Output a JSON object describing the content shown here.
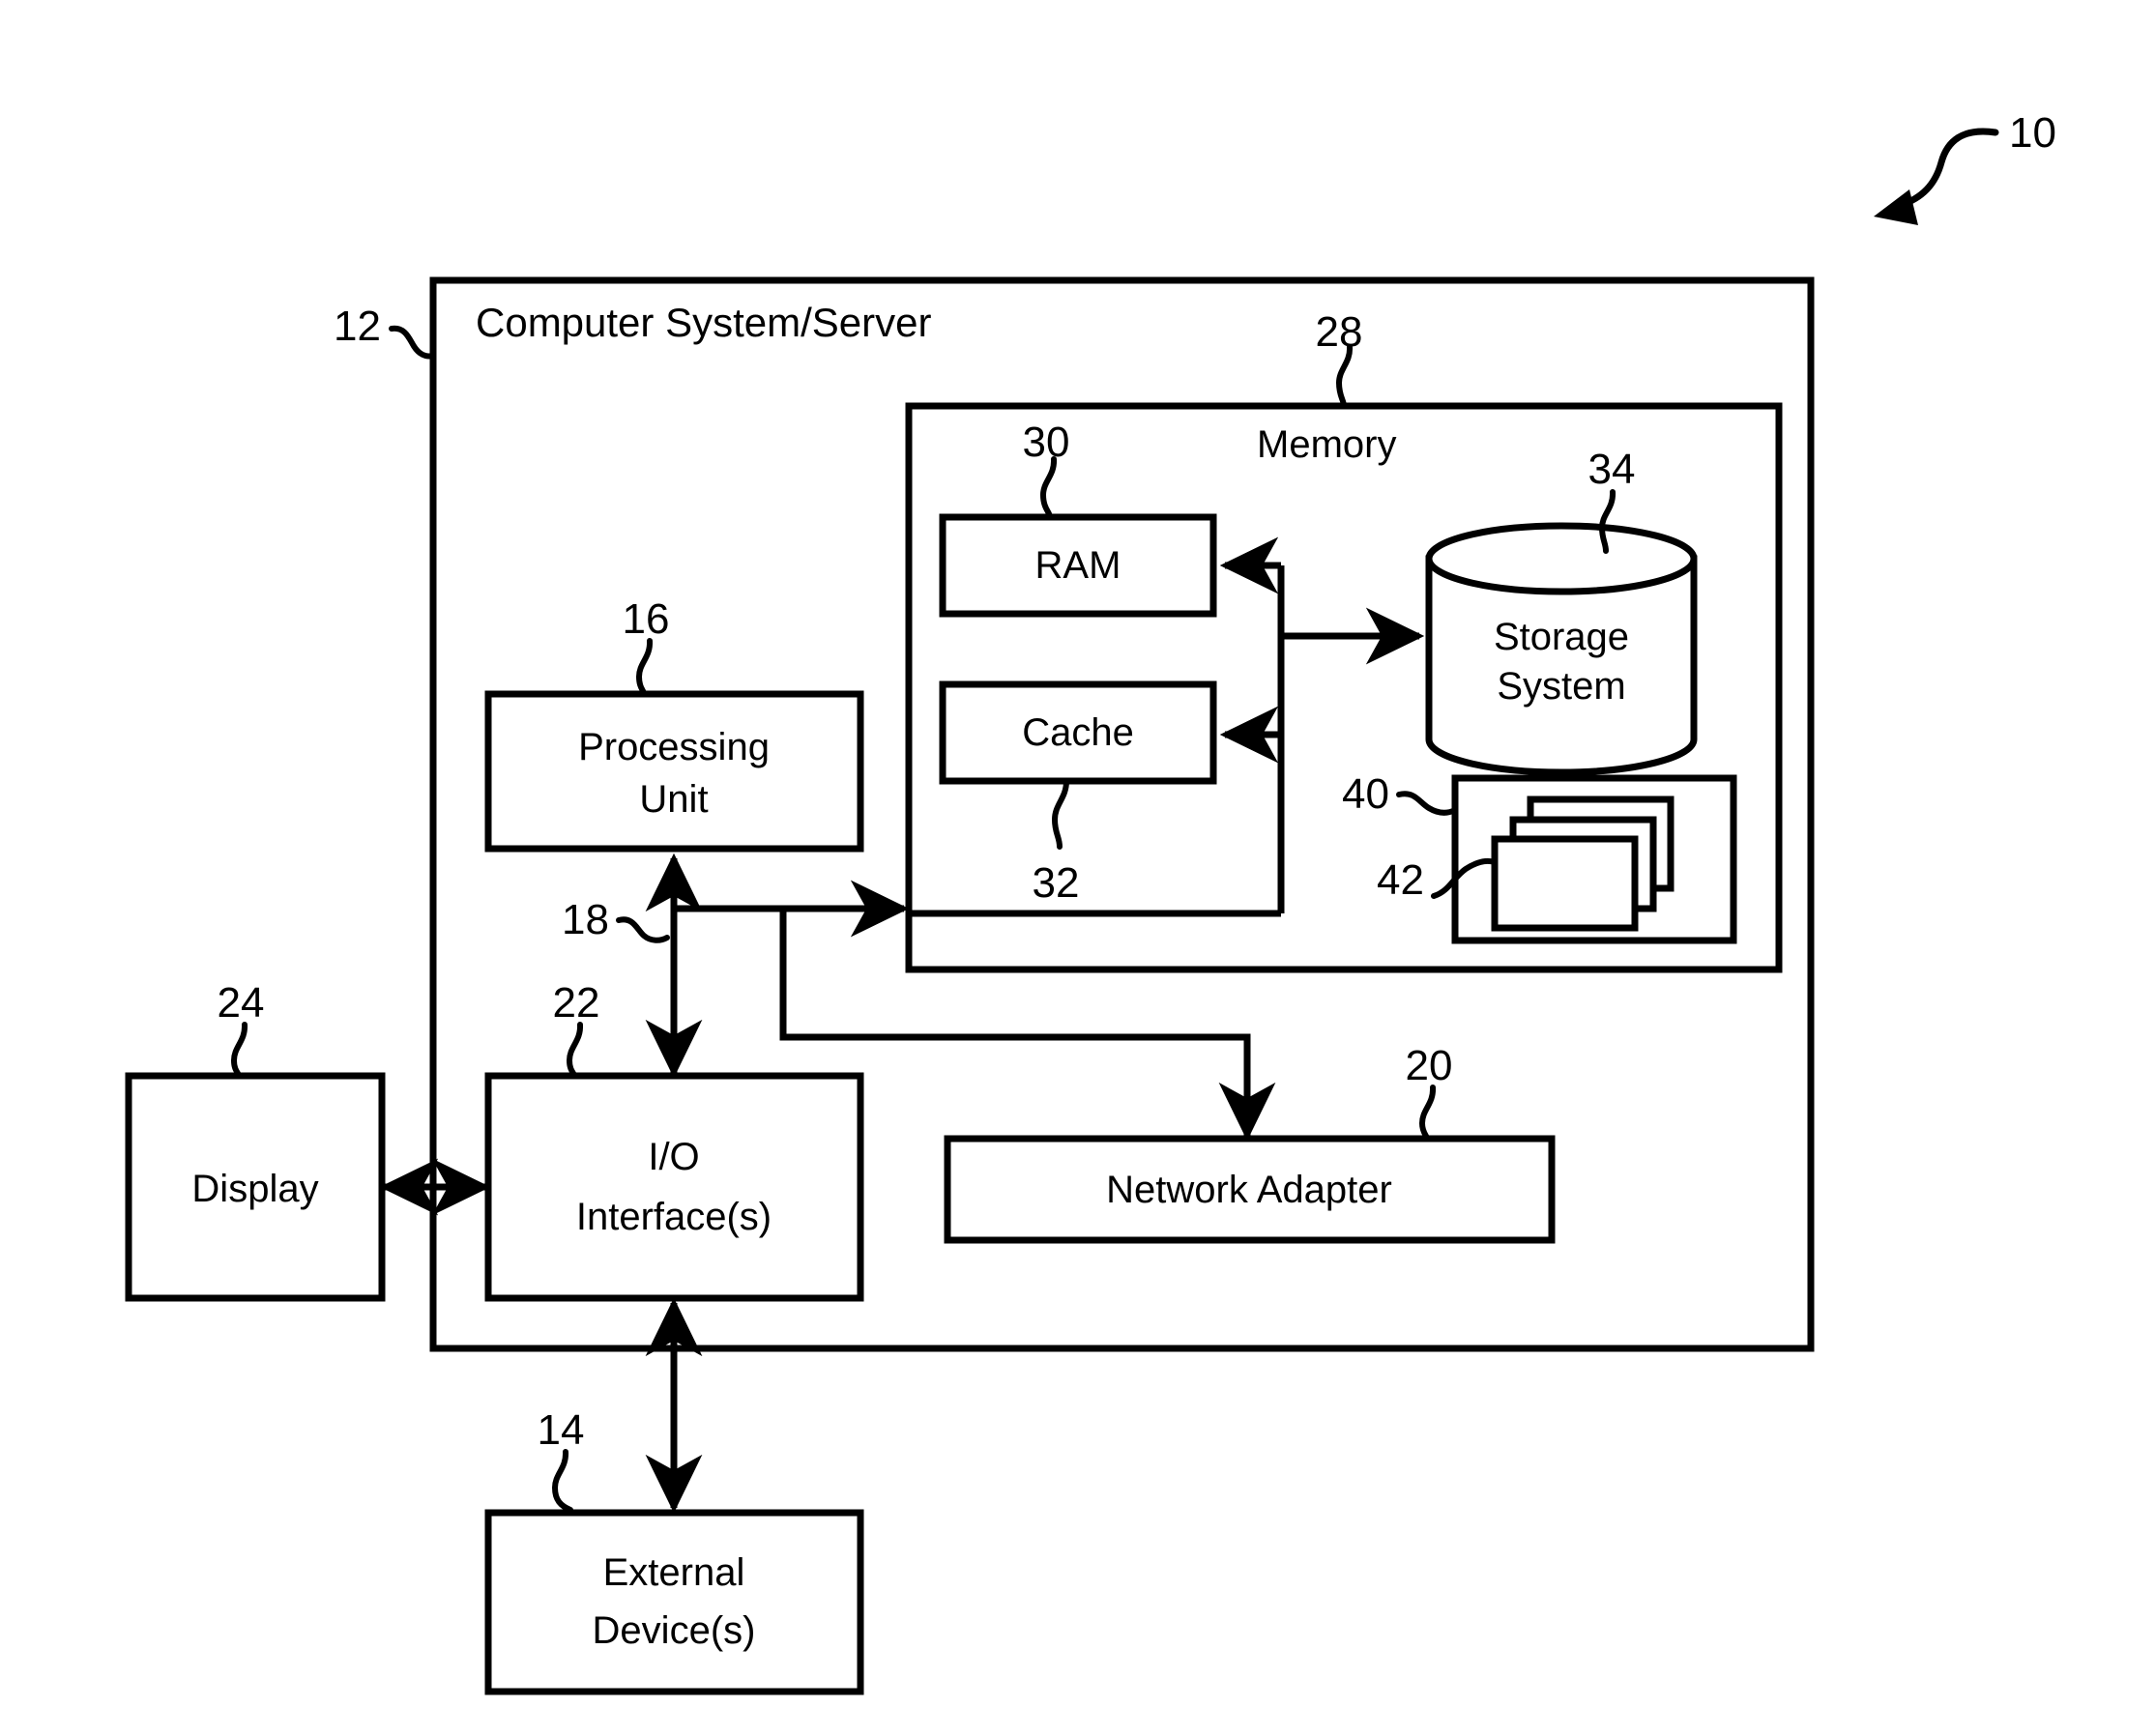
{
  "figure": {
    "figure_ref": "10",
    "outer_system": {
      "title": "Computer System/Server",
      "ref": "12"
    },
    "blocks": [
      {
        "key": "processing_unit",
        "label_line1": "Processing",
        "label_line2": "Unit",
        "ref": "16"
      },
      {
        "key": "memory",
        "label_line1": "Memory",
        "label_line2": "",
        "ref": "28"
      },
      {
        "key": "ram",
        "label_line1": "RAM",
        "label_line2": "",
        "ref": "30"
      },
      {
        "key": "cache",
        "label_line1": "Cache",
        "label_line2": "",
        "ref": "32"
      },
      {
        "key": "storage_system",
        "label_line1": "Storage",
        "label_line2": "System",
        "ref": "34"
      },
      {
        "key": "program_container",
        "label_line1": "",
        "label_line2": "",
        "ref": "40"
      },
      {
        "key": "program_modules",
        "label_line1": "",
        "label_line2": "",
        "ref": "42"
      },
      {
        "key": "io_interfaces",
        "label_line1": "I/O",
        "label_line2": "Interface(s)",
        "ref": "22"
      },
      {
        "key": "network_adapter",
        "label_line1": "Network Adapter",
        "label_line2": "",
        "ref": "20"
      },
      {
        "key": "display",
        "label_line1": "Display",
        "label_line2": "",
        "ref": "24"
      },
      {
        "key": "external_devices",
        "label_line1": "External",
        "label_line2": "Device(s)",
        "ref": "14"
      },
      {
        "key": "bus",
        "label_line1": "",
        "label_line2": "",
        "ref": "18"
      }
    ],
    "text": {
      "computer_system_server": "Computer System/Server",
      "memory": "Memory",
      "ram": "RAM",
      "cache": "Cache",
      "storage_line1": "Storage",
      "storage_line2": "System",
      "processing_line1": "Processing",
      "processing_line2": "Unit",
      "io_line1": "I/O",
      "io_line2": "Interface(s)",
      "network_adapter": "Network Adapter",
      "display": "Display",
      "external_line1": "External",
      "external_line2": "Device(s)"
    },
    "refs": {
      "figure": "10",
      "system": "12",
      "external_devices": "14",
      "processing_unit": "16",
      "bus": "18",
      "network_adapter": "20",
      "io_interfaces": "22",
      "display": "24",
      "memory": "28",
      "ram": "30",
      "cache": "32",
      "storage_system": "34",
      "program_container": "40",
      "program_modules": "42"
    },
    "colors": {
      "ink": "#000000",
      "paper": "#ffffff"
    }
  }
}
